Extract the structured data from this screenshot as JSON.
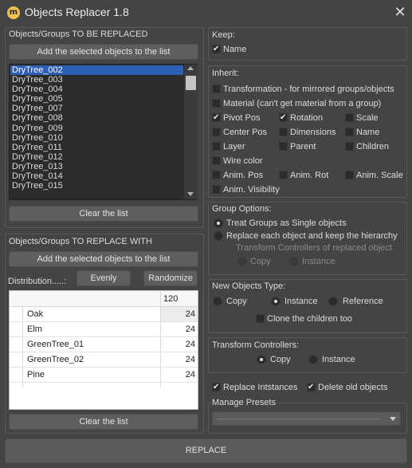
{
  "window": {
    "title": "Objects Replacer 1.8",
    "icon_text": "m",
    "close_glyph": "✕"
  },
  "left": {
    "replaced": {
      "label": "Objects/Groups TO BE REPLACED",
      "add_button": "Add the selected objects to the list",
      "items": [
        "DryTree_002",
        "DryTree_003",
        "DryTree_004",
        "DryTree_005",
        "DryTree_007",
        "DryTree_008",
        "DryTree_009",
        "DryTree_010",
        "DryTree_011",
        "DryTree_012",
        "DryTree_013",
        "DryTree_014",
        "DryTree_015"
      ],
      "selected_index": 0,
      "clear_button": "Clear the list"
    },
    "replace_with": {
      "label": "Objects/Groups TO REPLACE WITH",
      "add_button": "Add the selected objects to the list",
      "distribution_label": "Distribution.....:",
      "evenly_button": "Evenly",
      "randomize_button": "Randomize",
      "total": "120",
      "rows": [
        {
          "name": "Oak",
          "value": "24"
        },
        {
          "name": "Elm",
          "value": "24"
        },
        {
          "name": "GreenTree_01",
          "value": "24"
        },
        {
          "name": "GreenTree_02",
          "value": "24"
        },
        {
          "name": "Pine",
          "value": "24"
        }
      ],
      "clear_button": "Clear the list"
    }
  },
  "right": {
    "keep": {
      "label": "Keep:",
      "name_label": "Name",
      "name_checked": true
    },
    "inherit": {
      "label": "Inherit:",
      "transformation": "Transformation - for mirrored groups/objects",
      "material": "Material (can't get material from a group)",
      "pivot_pos": "Pivot Pos",
      "rotation": "Rotation",
      "scale": "Scale",
      "center_pos": "Center Pos",
      "dimensions": "Dimensions",
      "name": "Name",
      "layer": "Layer",
      "parent": "Parent",
      "children": "Children",
      "wire_color": "Wire color",
      "anim_pos": "Anim. Pos",
      "anim_rot": "Anim. Rot",
      "anim_scale": "Anim. Scale",
      "anim_visibility": "Anim. Visibility"
    },
    "group_options": {
      "label": "Group Options:",
      "single": "Treat Groups as Single objects",
      "hierarchy": "Replace each object and keep the hierarchy",
      "tc_label": "Transform Controllers of replaced object",
      "copy": "Copy",
      "instance": "Instance"
    },
    "new_type": {
      "label": "New Objects Type:",
      "copy": "Copy",
      "instance": "Instance",
      "reference": "Reference",
      "clone_children": "Clone the children too"
    },
    "transform_controllers": {
      "label": "Transform Controllers:",
      "copy": "Copy",
      "instance": "Instance"
    },
    "replace_instances": "Replace Intstances",
    "delete_old": "Delete old objects",
    "presets": {
      "label": "Manage Presets",
      "value": ""
    }
  },
  "replace_button": "REPLACE"
}
